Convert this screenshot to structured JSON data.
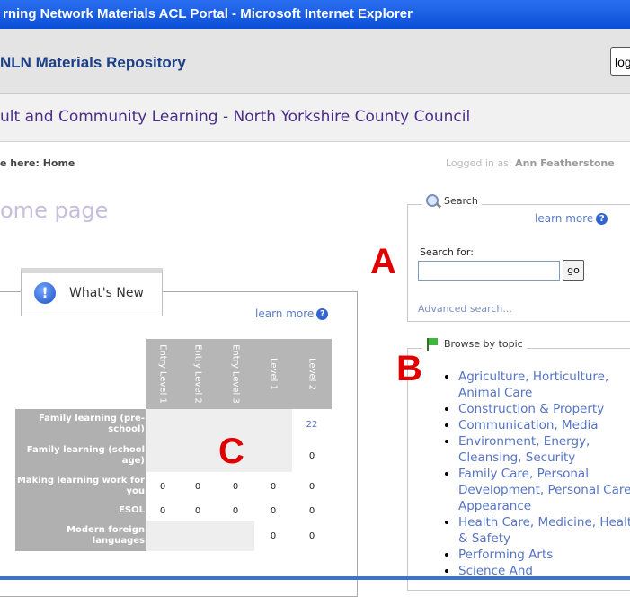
{
  "window": {
    "title": "rning Network Materials ACL Portal - Microsoft Internet Explorer"
  },
  "header": {
    "repo_title": "NLN Materials Repository",
    "login_label": "log",
    "org_title": "ult and Community Learning - North Yorkshire County Council"
  },
  "breadcrumb": {
    "text": "e here: Home"
  },
  "session": {
    "logged_prefix": "Logged in as:",
    "user": "Ann Featherstone"
  },
  "page_title": "ome page",
  "whats_new": {
    "tab_label": "What's New",
    "learn_more": "learn more",
    "columns": [
      "Entry Level 1",
      "Entry Level 2",
      "Entry Level 3",
      "Level 1",
      "Level 2"
    ],
    "rows": [
      {
        "label": "Family learning (pre-school)",
        "values": [
          "",
          "",
          "",
          "",
          "22"
        ]
      },
      {
        "label": "Family learning (school age)",
        "values": [
          "",
          "",
          "",
          "",
          "0"
        ]
      },
      {
        "label": "Making learning work for you",
        "values": [
          "0",
          "0",
          "0",
          "0",
          "0"
        ]
      },
      {
        "label": "ESOL",
        "values": [
          "0",
          "0",
          "0",
          "0",
          "0"
        ]
      },
      {
        "label": "Modern foreign languages",
        "values": [
          "",
          "",
          "",
          "0",
          "0"
        ]
      }
    ]
  },
  "search": {
    "legend": "Search",
    "learn_more": "learn more",
    "label": "Search for:",
    "value": "",
    "go_label": "go",
    "advanced": "Advanced search..."
  },
  "browse": {
    "legend": "Browse by topic",
    "topics": [
      "Agriculture, Horticulture, Animal Care",
      "Construction & Property",
      "Communication, Media",
      "Environment, Energy, Cleansing, Security",
      "Family Care, Personal Development, Personal Care & Appearance",
      "Health Care, Medicine, Health & Safety",
      "Performing Arts",
      "Science And"
    ]
  },
  "annotations": {
    "a": "A",
    "b": "B",
    "c": "C"
  },
  "colors": {
    "title_bar": "#0b4fd6",
    "marker": "#e00000",
    "link": "#5574c4"
  }
}
